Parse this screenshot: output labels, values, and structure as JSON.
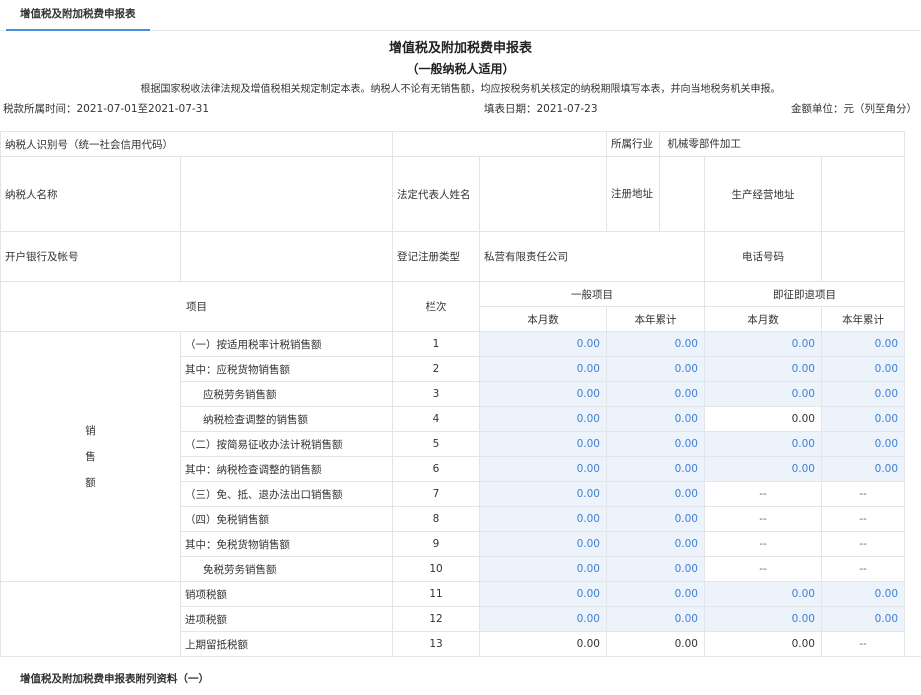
{
  "tab": {
    "label": "增值税及附加税费申报表"
  },
  "header": {
    "title": "增值税及附加税费申报表",
    "subtitle": "（一般纳税人适用）",
    "note": "根据国家税收法律法规及增值税相关规定制定本表。纳税人不论有无销售额，均应按税务机关核定的纳税期限填写本表，并向当地税务机关申报。",
    "period": "税款所属时间：2021-07-01至2021-07-31",
    "fill_date": "填表日期：2021-07-23",
    "unit": "金额单位：元（列至角分）"
  },
  "info": {
    "taxpayer_id_label": "纳税人识别号（统一社会信用代码）",
    "taxpayer_id_value": "",
    "industry_label": "所属行业",
    "industry_value": "机械零部件加工",
    "name_label": "纳税人名称",
    "name_value": "",
    "legal_rep_label": "法定代表人姓名",
    "legal_rep_value": "",
    "reg_address_label": "注册地址",
    "reg_address_value": "",
    "prod_address_label": "生产经营地址",
    "prod_address_value": "",
    "bank_label": "开户银行及帐号",
    "bank_value": "",
    "reg_type_label": "登记注册类型",
    "reg_type_value": "私营有限责任公司",
    "phone_label": "电话号码",
    "phone_value": ""
  },
  "columns": {
    "item": "项目",
    "line": "栏次",
    "general": "一般项目",
    "refund": "即征即退项目",
    "month": "本月数",
    "year": "本年累计"
  },
  "section_sales": {
    "chars": [
      "销",
      "售",
      "额"
    ]
  },
  "rows": [
    {
      "label": "（一）按适用税率计税销售额",
      "indent": false,
      "line": "1",
      "v": [
        "0.00",
        "0.00",
        "0.00",
        "0.00"
      ],
      "s": [
        "b",
        "b",
        "b",
        "b"
      ]
    },
    {
      "label": "其中：应税货物销售额",
      "indent": false,
      "line": "2",
      "v": [
        "0.00",
        "0.00",
        "0.00",
        "0.00"
      ],
      "s": [
        "b",
        "b",
        "b",
        "b"
      ]
    },
    {
      "label": "应税劳务销售额",
      "indent": true,
      "line": "3",
      "v": [
        "0.00",
        "0.00",
        "0.00",
        "0.00"
      ],
      "s": [
        "b",
        "b",
        "b",
        "b"
      ]
    },
    {
      "label": "纳税检查调整的销售额",
      "indent": true,
      "line": "4",
      "v": [
        "0.00",
        "0.00",
        "0.00",
        "0.00"
      ],
      "s": [
        "b",
        "b",
        "p",
        "b"
      ]
    },
    {
      "label": "（二）按简易征收办法计税销售额",
      "indent": false,
      "line": "5",
      "v": [
        "0.00",
        "0.00",
        "0.00",
        "0.00"
      ],
      "s": [
        "b",
        "b",
        "b",
        "b"
      ]
    },
    {
      "label": "其中：纳税检查调整的销售额",
      "indent": false,
      "line": "6",
      "v": [
        "0.00",
        "0.00",
        "0.00",
        "0.00"
      ],
      "s": [
        "b",
        "b",
        "b",
        "b"
      ]
    },
    {
      "label": "（三）免、抵、退办法出口销售额",
      "indent": false,
      "line": "7",
      "v": [
        "0.00",
        "0.00",
        "--",
        "--"
      ],
      "s": [
        "b",
        "b",
        "d",
        "d"
      ]
    },
    {
      "label": "（四）免税销售额",
      "indent": false,
      "line": "8",
      "v": [
        "0.00",
        "0.00",
        "--",
        "--"
      ],
      "s": [
        "b",
        "b",
        "d",
        "d"
      ]
    },
    {
      "label": "其中：免税货物销售额",
      "indent": false,
      "line": "9",
      "v": [
        "0.00",
        "0.00",
        "--",
        "--"
      ],
      "s": [
        "b",
        "b",
        "d",
        "d"
      ]
    },
    {
      "label": "免税劳务销售额",
      "indent": true,
      "line": "10",
      "v": [
        "0.00",
        "0.00",
        "--",
        "--"
      ],
      "s": [
        "b",
        "b",
        "d",
        "d"
      ]
    },
    {
      "label": "销项税额",
      "indent": false,
      "line": "11",
      "v": [
        "0.00",
        "0.00",
        "0.00",
        "0.00"
      ],
      "s": [
        "b",
        "b",
        "b",
        "b"
      ]
    },
    {
      "label": "进项税额",
      "indent": false,
      "line": "12",
      "v": [
        "0.00",
        "0.00",
        "0.00",
        "0.00"
      ],
      "s": [
        "b",
        "b",
        "b",
        "b"
      ]
    },
    {
      "label": "上期留抵税额",
      "indent": false,
      "line": "13",
      "v": [
        "0.00",
        "0.00",
        "0.00",
        "--"
      ],
      "s": [
        "p",
        "p",
        "p",
        "d"
      ]
    }
  ],
  "footer": {
    "title": "增值税及附加税费申报表附列资料（一）"
  }
}
